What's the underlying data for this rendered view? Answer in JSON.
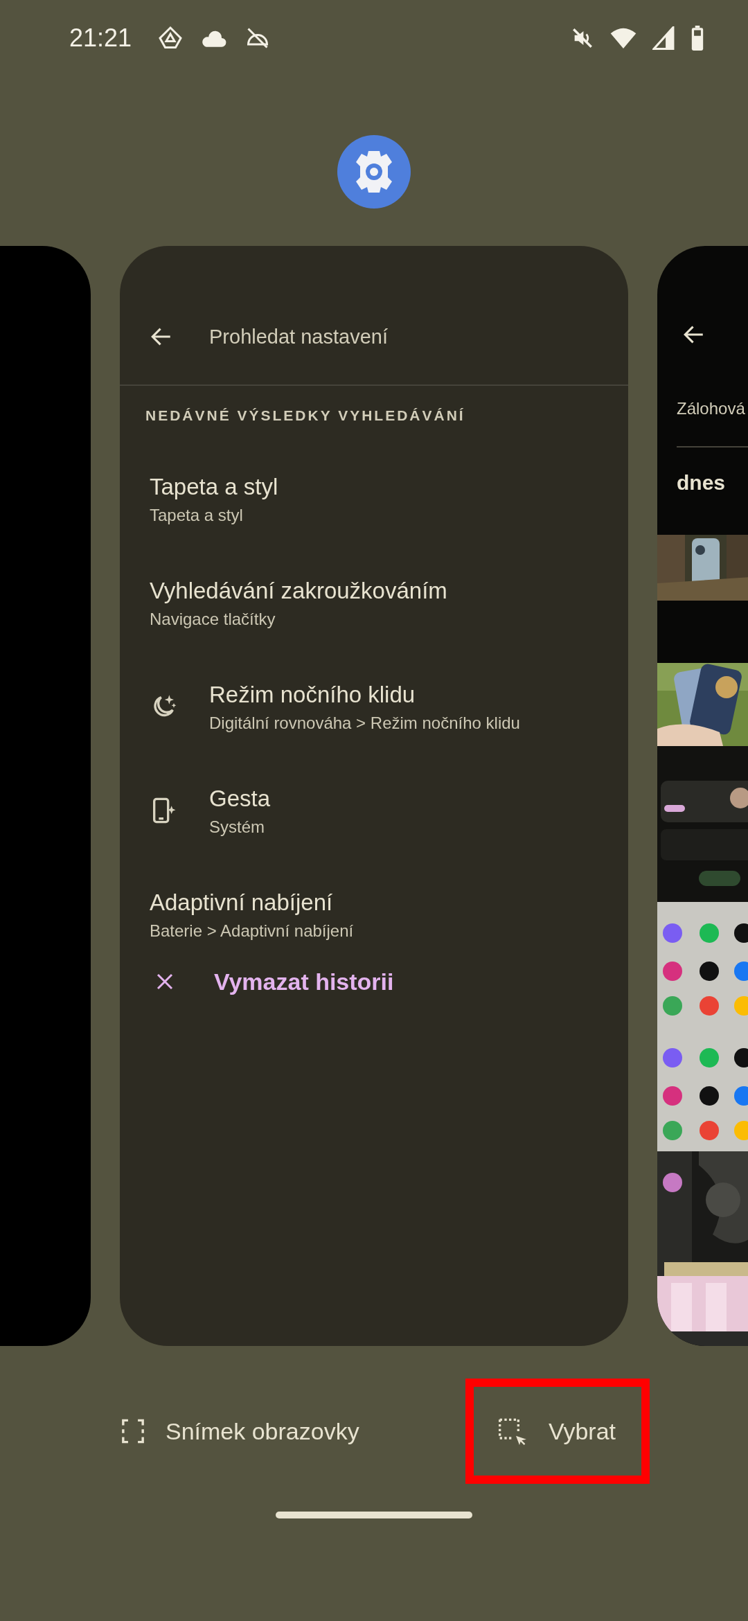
{
  "status_bar": {
    "time": "21:21"
  },
  "cards": [
    {
      "kind": "blank"
    },
    {
      "kind": "settings_search",
      "search": {
        "placeholder": "Prohledat nastavení"
      },
      "section_header": "NEDÁVNÉ VÝSLEDKY VYHLEDÁVÁNÍ",
      "results": [
        {
          "kind": "plain",
          "title": "Tapeta a styl",
          "subtitle": "Tapeta a styl"
        },
        {
          "kind": "plain",
          "title": "Vyhledávání zakroužkováním",
          "subtitle": "Navigace tlačítky"
        },
        {
          "kind": "bedtime",
          "title": "Režim nočního klidu",
          "subtitle": "Digitální rovnováha > Režim nočního klidu"
        },
        {
          "kind": "gesture",
          "title": "Gesta",
          "subtitle": "Systém"
        },
        {
          "kind": "plain",
          "title": "Adaptivní nabíjení",
          "subtitle": "Baterie > Adaptivní nabíjení"
        }
      ],
      "clear_action": "Vymazat historii"
    },
    {
      "kind": "gallery",
      "tab": "Zálohová",
      "date_header": "dnes"
    }
  ],
  "actions": [
    {
      "kind": "screenshot",
      "label": "Snímek obrazovky",
      "highlighted": false
    },
    {
      "kind": "select",
      "label": "Vybrat",
      "highlighted": true
    }
  ]
}
